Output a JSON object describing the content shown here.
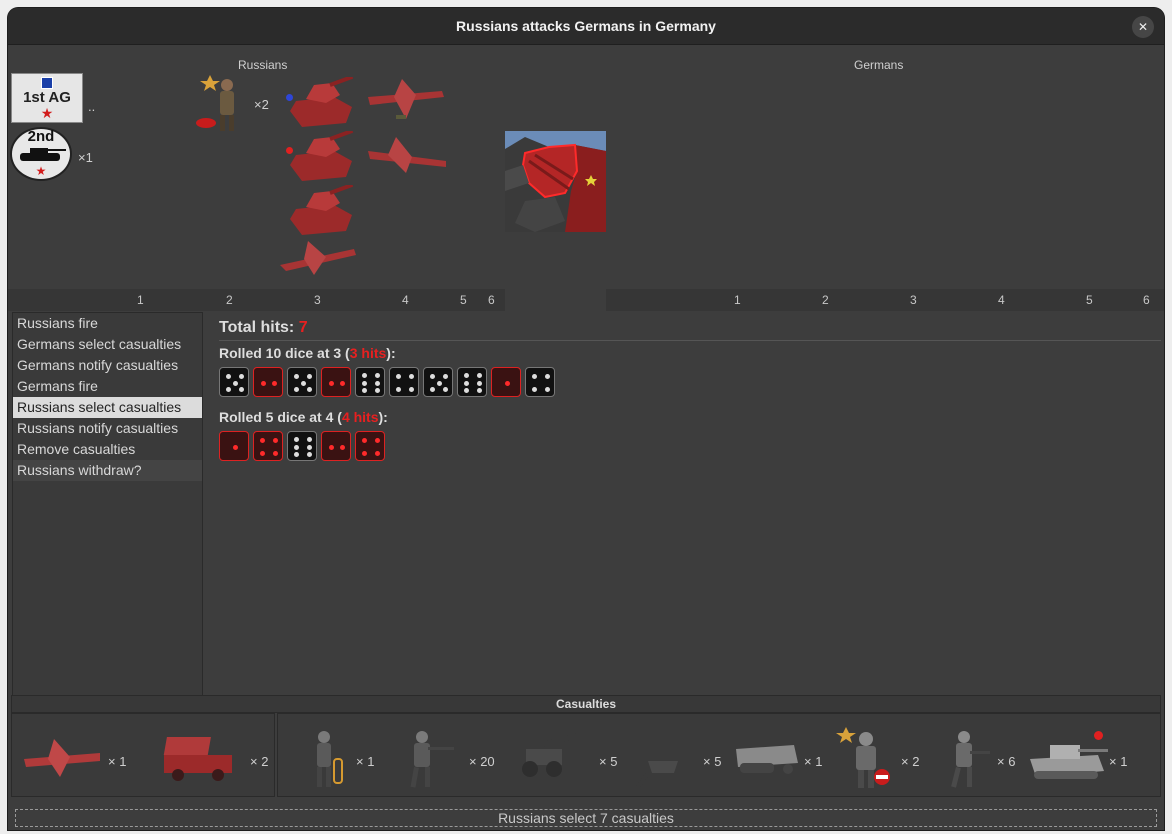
{
  "window": {
    "title": "Russians attacks Germans in Germany"
  },
  "board": {
    "attacker_label": "Russians",
    "defender_label": "Germans",
    "chip_1st": "1st AG",
    "chip_1st_suffix": "..",
    "chip_2nd": "2nd",
    "chip_2nd_mult": "×1",
    "infantry_mult": "×2",
    "attacker_columns": [
      "1",
      "2",
      "3",
      "4",
      "5",
      "6"
    ],
    "defender_columns": [
      "1",
      "2",
      "3",
      "4",
      "5",
      "6"
    ]
  },
  "steps": {
    "items": [
      "Russians fire",
      "Germans select casualties",
      "Germans notify casualties",
      "Germans fire",
      "Russians select casualties",
      "Russians notify casualties",
      "Remove casualties",
      "Russians withdraw?"
    ],
    "active_index": 4
  },
  "results": {
    "total_label": "Total hits: ",
    "total_value": "7",
    "rolls": [
      {
        "prefix": "Rolled 10 dice at 3 (",
        "hits": "3 hits",
        "suffix": "):",
        "dice": [
          5,
          2,
          5,
          2,
          6,
          4,
          5,
          6,
          1,
          4
        ],
        "hit_threshold": 3
      },
      {
        "prefix": "Rolled 5 dice at 4 (",
        "hits": "4 hits",
        "suffix": "):",
        "dice": [
          1,
          4,
          6,
          2,
          4
        ],
        "hit_threshold": 4
      }
    ]
  },
  "casualties": {
    "header": "Casualties",
    "russian_units": [
      {
        "icon": "fighter-plane-icon",
        "mult": "× 1"
      },
      {
        "icon": "rocket-truck-icon",
        "mult": "× 2"
      }
    ],
    "german_units": [
      {
        "icon": "engineer-infantry-icon",
        "mult": "× 1"
      },
      {
        "icon": "infantry-icon",
        "mult": "× 20"
      },
      {
        "icon": "artillery-icon",
        "mult": "× 5"
      },
      {
        "icon": "anti-tank-gun-icon",
        "mult": "× 5"
      },
      {
        "icon": "halftrack-icon",
        "mult": "× 1"
      },
      {
        "icon": "officer-infantry-icon",
        "mult": "× 2"
      },
      {
        "icon": "mech-infantry-icon",
        "mult": "× 6"
      },
      {
        "icon": "heavy-tank-icon",
        "mult": "× 1"
      }
    ]
  },
  "status": {
    "text": "Russians select 7 casualties"
  },
  "colors": {
    "hit_red": "#e82020",
    "russian_unit": "#b03a3a",
    "german_unit": "#8a8a8a"
  }
}
